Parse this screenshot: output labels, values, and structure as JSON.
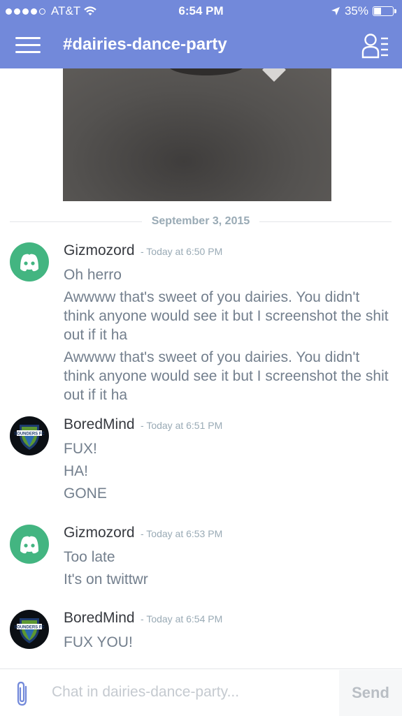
{
  "status_bar": {
    "carrier": "AT&T",
    "time": "6:54 PM",
    "battery": "35%",
    "battery_level": 0.35,
    "signal_bars": 4
  },
  "navbar": {
    "channel_title": "#dairies-dance-party"
  },
  "date_divider": "September 3, 2015",
  "messages": [
    {
      "username": "Gizmozord",
      "timestamp": "- Today at 6:50 PM",
      "lines": [
        "Oh herro",
        "Awwww that's sweet of you dairies. You didn't think anyone would see it but I screenshot the shit out if it ha",
        "Awwww that's sweet of you dairies. You didn't think anyone would see it but I screenshot the shit out if it ha"
      ]
    },
    {
      "username": "BoredMind",
      "timestamp": "- Today at 6:51 PM",
      "avatar_text": "SOUNDERS FC",
      "lines": [
        "FUX!",
        "HA!",
        "GONE"
      ]
    },
    {
      "username": "Gizmozord",
      "timestamp": "- Today at 6:53 PM",
      "lines": [
        "Too late",
        "It's on twittwr"
      ]
    },
    {
      "username": "BoredMind",
      "timestamp": "- Today at 6:54 PM",
      "avatar_text": "SOUNDERS FC",
      "lines": [
        "FUX YOU!"
      ]
    }
  ],
  "chat_bar": {
    "placeholder": "Chat in dairies-dance-party...",
    "send_label": "Send"
  },
  "colors": {
    "brand": "#7289da",
    "discord_avatar": "#43b581",
    "username": "#36393f",
    "message_text": "#737f8d",
    "timestamp": "#99aab5"
  },
  "icons": [
    "menu-icon",
    "members-list-icon",
    "discord-logo-icon",
    "sounders-crest-icon",
    "paperclip-icon",
    "location-arrow-icon",
    "wifi-icon",
    "battery-icon"
  ]
}
